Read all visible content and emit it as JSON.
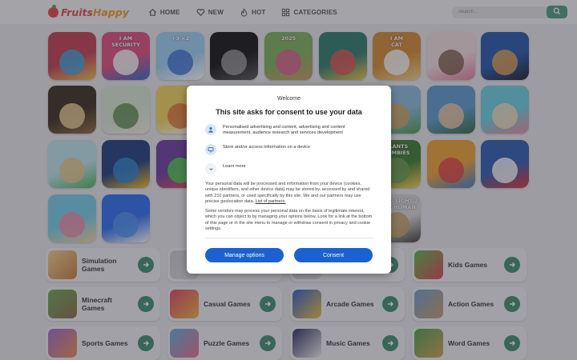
{
  "header": {
    "logo_part1": "Fruits",
    "logo_part2": "Happy",
    "nav": [
      {
        "label": "HOME",
        "icon": "home-icon"
      },
      {
        "label": "NEW",
        "icon": "heart-icon"
      },
      {
        "label": "HOT",
        "icon": "flame-icon"
      },
      {
        "label": "CATEGORIES",
        "icon": "grid-icon"
      }
    ],
    "search_placeholder": "Search...",
    "search_icon": "search-icon"
  },
  "games": [
    {
      "name": "shelf-sort-game",
      "tile_text": "",
      "palette": [
        "#c23b4d",
        "#f0c04a",
        "#3fa1d9"
      ]
    },
    {
      "name": "i-am-security-game",
      "tile_text": "I AM\nSECURITY",
      "palette": [
        "#e04b7a",
        "#3366cc",
        "#ffffff"
      ]
    },
    {
      "name": "math-runner-game",
      "tile_text": "+3 ×2",
      "palette": [
        "#9ed0f5",
        "#ffffff",
        "#3a6fd8"
      ]
    },
    {
      "name": "dark-cube-game",
      "tile_text": "",
      "palette": [
        "#111111",
        "#555555",
        "#999999"
      ]
    },
    {
      "name": "farm-2025-game",
      "tile_text": "2025",
      "palette": [
        "#7fb05a",
        "#c99a5a",
        "#e05a90"
      ]
    },
    {
      "name": "block-puzzle-game",
      "tile_text": "",
      "palette": [
        "#2a7a6a",
        "#f4c542",
        "#e05050"
      ]
    },
    {
      "name": "i-am-cat-game",
      "tile_text": "I AM\nCAT",
      "palette": [
        "#d68a2e",
        "#f5d38a",
        "#ffffff"
      ]
    },
    {
      "name": "grocery-store-game",
      "tile_text": "",
      "palette": [
        "#f3dfe0",
        "#e67a9a",
        "#7a5a4a"
      ]
    },
    {
      "name": "superhero-game",
      "tile_text": "",
      "palette": [
        "#2255aa",
        "#1a1a2a",
        "#e0a050"
      ]
    },
    {
      "name": "dark-forest-game",
      "tile_text": "",
      "palette": [
        "#3a2a1a",
        "#8a6a3a",
        "#f0d090"
      ]
    },
    {
      "name": "dog-cat-game",
      "tile_text": "",
      "palette": [
        "#d8e8d0",
        "#f4efe0",
        "#5a8a4a"
      ]
    },
    {
      "name": "yellow-slide-game",
      "tile_text": "",
      "palette": [
        "#f3d458",
        "#ffffff",
        "#e07030"
      ]
    },
    {
      "name": "sky-hidden-1",
      "tile_text": "",
      "palette": [
        "#aad4f0",
        "#f0f0f0",
        "#cccccc"
      ]
    },
    {
      "name": "hidden-2",
      "tile_text": "",
      "palette": [
        "#cccccc",
        "#dddddd",
        "#bbbbbb"
      ]
    },
    {
      "name": "hidden-3",
      "tile_text": "",
      "palette": [
        "#cccccc",
        "#dddddd",
        "#bbbbbb"
      ]
    },
    {
      "name": "sky-road-game",
      "tile_text": "",
      "palette": [
        "#88bbdd",
        "#4a9a4a",
        "#cfa35a"
      ]
    },
    {
      "name": "supermarket-cashier-game",
      "tile_text": "",
      "palette": [
        "#5a9ad0",
        "#2e6a3a",
        "#f0c8a0"
      ]
    },
    {
      "name": "pink-house-game",
      "tile_text": "",
      "palette": [
        "#6ad0e0",
        "#f08aa0",
        "#f4e0c0"
      ]
    },
    {
      "name": "island-tree-game",
      "tile_text": "",
      "palette": [
        "#bde6ee",
        "#4ab45a",
        "#e8c888"
      ]
    },
    {
      "name": "tetris-blocks-game",
      "tile_text": "",
      "palette": [
        "#1c3a7a",
        "#f4c020",
        "#2a80d0"
      ]
    },
    {
      "name": "bubble-shooter-game",
      "tile_text": "",
      "palette": [
        "#6a3aa0",
        "#f04a4a",
        "#4ad04a"
      ]
    },
    {
      "name": "hidden-4",
      "tile_text": "",
      "palette": [
        "#cccccc",
        "#dddddd",
        "#bbbbbb"
      ]
    },
    {
      "name": "hidden-5",
      "tile_text": "",
      "palette": [
        "#cccccc",
        "#dddddd",
        "#bbbbbb"
      ]
    },
    {
      "name": "blue-monster-game",
      "tile_text": "",
      "palette": [
        "#2a6ad0",
        "#f03a3a",
        "#ffd24a"
      ]
    },
    {
      "name": "plants-vs-zombies-game",
      "tile_text": "PLANTS\nZOMBIES",
      "palette": [
        "#3a7a2a",
        "#ffd24a",
        "#6a9a4a"
      ]
    },
    {
      "name": "subway-runner-game",
      "tile_text": "",
      "palette": [
        "#f0a030",
        "#3a80d0",
        "#e04040"
      ]
    },
    {
      "name": "pokeball-game",
      "tile_text": "",
      "palette": [
        "#2a5ab0",
        "#e03030",
        "#ffffff"
      ]
    },
    {
      "name": "toca-world-game",
      "tile_text": "",
      "palette": [
        "#78cde8",
        "#f7d8a0",
        "#f08aa8"
      ]
    },
    {
      "name": "roblox-game",
      "tile_text": "",
      "palette": [
        "#2a6cf0",
        "#ffffff",
        "#4a90f0"
      ]
    },
    {
      "name": "hidden-6",
      "tile_text": "",
      "palette": [
        "#cccccc",
        "#dddddd",
        "#bbbbbb"
      ]
    },
    {
      "name": "hidden-7",
      "tile_text": "",
      "palette": [
        "#cccccc",
        "#dddddd",
        "#bbbbbb"
      ]
    },
    {
      "name": "desert-warrior-game",
      "tile_text": "",
      "palette": [
        "#e8c888",
        "#8a5a2a",
        "#f0e0c0"
      ]
    },
    {
      "name": "dark-knight-game",
      "tile_text": "",
      "palette": [
        "#2a2a2a",
        "#6a5a4a",
        "#aaaaaa"
      ]
    },
    {
      "name": "dying-light-2-game",
      "tile_text": "DYING LIGHT 2\nSTAY HUMAN",
      "palette": [
        "#d8d8d8",
        "#3a3a3a",
        "#c8a060"
      ]
    }
  ],
  "categories": [
    {
      "label": "Simulation\nGames",
      "palette": [
        "#f4d28a",
        "#c97a3a"
      ]
    },
    {
      "label": "",
      "palette": [
        "#cccccc",
        "#dddddd"
      ]
    },
    {
      "label": "",
      "palette": [
        "#cccccc",
        "#dddddd"
      ]
    },
    {
      "label": "Kids Games",
      "palette": [
        "#5ab84a",
        "#e04050"
      ]
    },
    {
      "label": "Minecraft\nGames",
      "palette": [
        "#6aa84a",
        "#8a6a4a"
      ]
    },
    {
      "label": "Casual Games",
      "palette": [
        "#e04060",
        "#f4b040"
      ]
    },
    {
      "label": "Arcade Games",
      "palette": [
        "#2a5ad0",
        "#f0c040"
      ]
    },
    {
      "label": "Action Games",
      "palette": [
        "#6aa0d0",
        "#c89a6a"
      ]
    },
    {
      "label": "Sports Games",
      "palette": [
        "#9a6ad0",
        "#f08a4a"
      ]
    },
    {
      "label": "Puzzle Games",
      "palette": [
        "#5ab0e0",
        "#f06a8a"
      ]
    },
    {
      "label": "Music Games",
      "palette": [
        "#2a2a5a",
        "#f0f0f0"
      ]
    },
    {
      "label": "Word Games",
      "palette": [
        "#4aa04a",
        "#d0a050"
      ]
    }
  ],
  "modal": {
    "welcome": "Welcome",
    "title": "This site asks for consent to use your data",
    "items": [
      {
        "icon": "person-icon",
        "text": "Personalised advertising and content, advertising and content measurement, audience research and services development"
      },
      {
        "icon": "device-icon",
        "text": "Store and/or access information on a device"
      },
      {
        "icon": "chevron-down-icon",
        "text": "Learn more"
      }
    ],
    "body1": "Your personal data will be processed and information from your device (cookies, unique identifiers, and other device data) may be stored by, accessed by and shared with 210 partners, or used specifically by this site. We and our partners may use precise geolocation data. ",
    "partners_link": "List of partners.",
    "body2": "Some vendors may process your personal data on the basis of legitimate interest, which you can object to by managing your options below. Look for a link at the bottom of this page or in the site menu to manage or withdraw consent in privacy and cookie settings.",
    "manage_button": "Manage options",
    "consent_button": "Consent",
    "button_color": "#1b61d0"
  }
}
